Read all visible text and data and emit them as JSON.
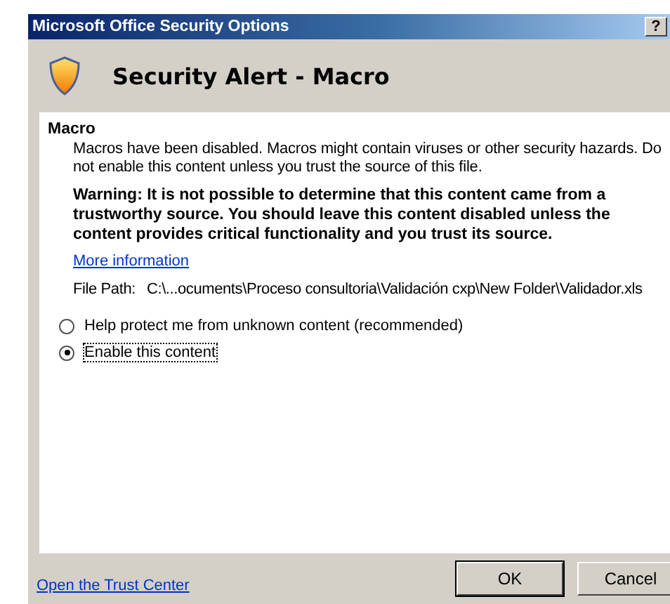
{
  "window": {
    "title": "Microsoft Office Security Options",
    "help_button": "?"
  },
  "header": {
    "title": "Security Alert - Macro"
  },
  "section": {
    "heading": "Macro",
    "description": "Macros have been disabled. Macros might contain viruses or other security hazards. Do not enable this content unless you trust the source of this file.",
    "warning": "Warning: It is not possible to determine that this content came from a trustworthy source. You should leave this content disabled unless the content provides critical functionality and you trust its source.",
    "more_info_link": "More information",
    "file_path_label": "File Path:",
    "file_path": "C:\\...ocuments\\Proceso consultoria\\Validación cxp\\New Folder\\Validador.xls"
  },
  "options": [
    {
      "label": "Help protect me from unknown content (recommended)",
      "selected": false
    },
    {
      "label": "Enable this content",
      "selected": true
    }
  ],
  "footer": {
    "trust_center_link": "Open the Trust Center",
    "buttons": [
      {
        "label": "OK",
        "kind": "default"
      },
      {
        "label": "Cancel",
        "kind": "normal"
      }
    ]
  }
}
